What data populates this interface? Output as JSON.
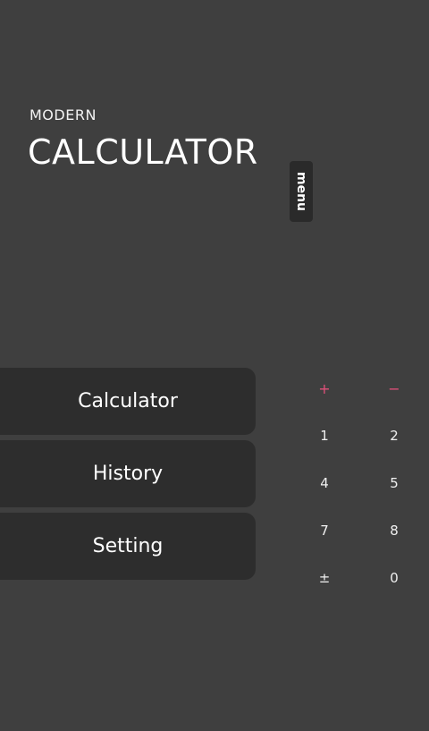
{
  "header": {
    "subtitle": "MODERN",
    "title": "CALCULATOR"
  },
  "menu_tab": {
    "label": "menu"
  },
  "nav": {
    "items": [
      {
        "label": "Calculator"
      },
      {
        "label": "History"
      },
      {
        "label": "Setting"
      }
    ]
  },
  "keypad": {
    "keys": [
      {
        "label": "+"
      },
      {
        "label": "−"
      },
      {
        "label": "1"
      },
      {
        "label": "2"
      },
      {
        "label": "4"
      },
      {
        "label": "5"
      },
      {
        "label": "7"
      },
      {
        "label": "8"
      },
      {
        "label": "±"
      },
      {
        "label": "0"
      }
    ]
  },
  "colors": {
    "background": "#3f3f3f",
    "panel": "#2d2d2d",
    "operator_accent": "#e0507a"
  }
}
